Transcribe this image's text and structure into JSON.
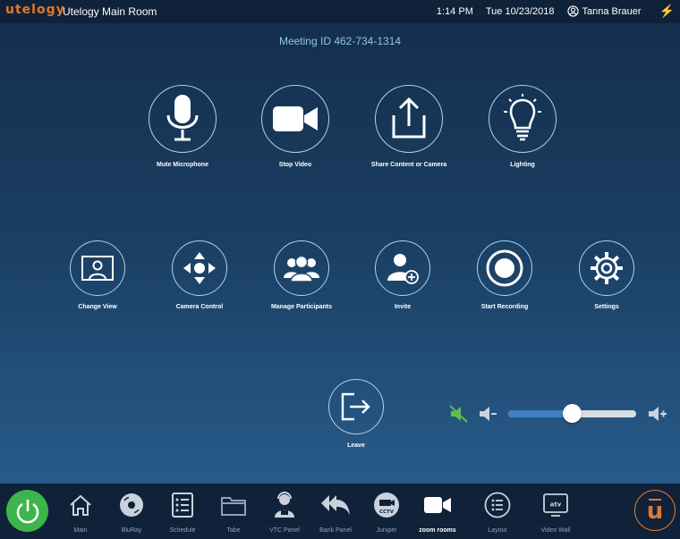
{
  "header": {
    "brand": "utelogy",
    "room_name": "Utelogy Main Room",
    "time": "1:14 PM",
    "date": "Tue 10/23/2018",
    "user_name": "Tanna Brauer",
    "power_status_icon": "lightning-bolt-icon"
  },
  "meeting": {
    "id_text": "Meeting ID 462-734-1314"
  },
  "actions_row1": [
    {
      "label": "Mute Microphone",
      "icon": "microphone-icon"
    },
    {
      "label": "Stop Video",
      "icon": "video-camera-icon"
    },
    {
      "label": "Share Content or Camera",
      "icon": "share-upload-icon"
    },
    {
      "label": "Lighting",
      "icon": "lightbulb-icon"
    }
  ],
  "actions_row2": [
    {
      "label": "Change View",
      "icon": "change-view-icon"
    },
    {
      "label": "Camera Control",
      "icon": "dpad-arrows-icon"
    },
    {
      "label": "Manage Participants",
      "icon": "participants-icon"
    },
    {
      "label": "Invite",
      "icon": "invite-user-icon"
    },
    {
      "label": "Start Recording",
      "icon": "record-icon"
    },
    {
      "label": "Settings",
      "icon": "gear-icon"
    }
  ],
  "leave": {
    "label": "Leave",
    "icon": "leave-exit-icon"
  },
  "volume": {
    "level": 0.5,
    "muted_icon": "speaker-muted-icon",
    "down_icon": "volume-down-icon",
    "up_icon": "volume-up-icon"
  },
  "bottom_nav": [
    {
      "label": "Main",
      "icon": "home-icon",
      "active": false
    },
    {
      "label": "BluRay",
      "icon": "disc-icon",
      "active": false
    },
    {
      "label": "Schedule",
      "icon": "list-icon",
      "active": false
    },
    {
      "label": "Tabe",
      "icon": "folder-icon",
      "active": false
    },
    {
      "label": "VTC Panel",
      "icon": "operator-icon",
      "active": false
    },
    {
      "label": "Bank Panel",
      "icon": "reply-all-icon",
      "active": false
    },
    {
      "label": "Juniper",
      "icon": "cctv-icon",
      "active": false
    },
    {
      "label": "zoom rooms",
      "icon": "video-camera-icon",
      "active": true
    },
    {
      "label": "Layout",
      "icon": "layout-list-icon",
      "active": false
    },
    {
      "label": "Video Wall",
      "icon": "atv-icon",
      "active": false
    }
  ],
  "bottom_left_icon": "power-icon",
  "bottom_right": {
    "letter": "u",
    "icon": "utelogy-logo-icon"
  },
  "colors": {
    "accent_orange": "#e0782f",
    "power_green": "#3db54a",
    "mute_green": "#5fbf4f",
    "slider_fill": "#3f7fc1",
    "circle_border": "#a9d3f0",
    "meeting_id": "#8fc4ea"
  }
}
